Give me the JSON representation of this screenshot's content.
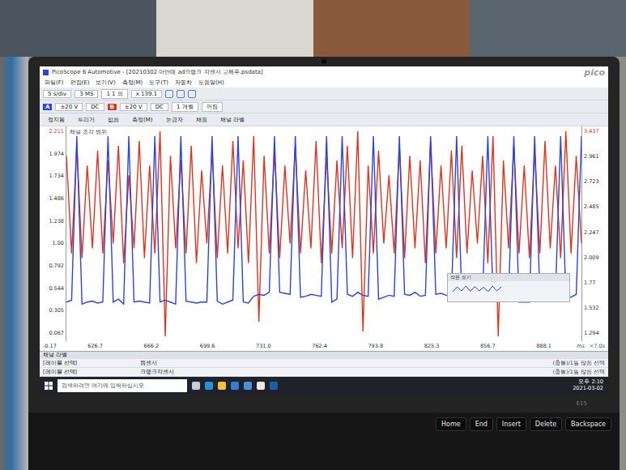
{
  "window": {
    "title": "PicoScope 6 Automotive - [20210302 아반떼 ad크랭크 각센서 교체후.psdata]",
    "logo": "pico"
  },
  "menu": [
    "파일(F)",
    "편집(E)",
    "보기(V)",
    "측정(M)",
    "도구(T)",
    "자동차",
    "도움말(H)"
  ],
  "toolbar1": [
    "5 s/div",
    "3 MS",
    "1 1 의",
    "x 139.1"
  ],
  "channels": [
    {
      "name": "A",
      "range": "±20 V",
      "coupling": "DC",
      "color": "#2a44e0"
    },
    {
      "name": "B",
      "range": "±20 V",
      "coupling": "DC",
      "color": "#e0341f"
    }
  ],
  "toolbar2": [
    "1 개월",
    "꺼짐"
  ],
  "toolbar3": [
    "정지됨",
    "트리거",
    "없음",
    "측정(M)",
    "눈금자",
    "채움",
    "채널 라벨"
  ],
  "chart": {
    "label": "채널 조각 범위",
    "left_top": "2.211",
    "right_top": "3.437",
    "y_left": [
      "1.974",
      "1.734",
      "1.486",
      "1.238",
      "1.00",
      "0.792",
      "0.544",
      "0.305",
      "0.067"
    ],
    "y_right": [
      "2.961",
      "2.723",
      "2.485",
      "2.247",
      "2.009",
      "1.77",
      "1.532",
      "1.294"
    ],
    "x_start": "-0.17",
    "x_ticks": [
      "626.7",
      "666.2",
      "699.6",
      "731.0",
      "762.4",
      "793.8",
      "825.3",
      "856.7",
      "888.1"
    ],
    "unit": "ms",
    "zoom": "×7.0s",
    "series": [
      {
        "name": "B",
        "color": "#e0341f",
        "values": [
          1.8,
          0.8,
          1.9,
          0.75,
          1.7,
          0.85,
          1.85,
          0.8,
          1.75,
          0.9,
          1.9,
          0.7,
          1.6,
          0.85,
          1.95,
          0.75,
          1.7,
          0.8,
          2.05,
          -0.05,
          1.8,
          0.85,
          1.75,
          0.8,
          1.9,
          0.7,
          1.65,
          0.9,
          1.85,
          0.75,
          1.7,
          0.8,
          1.95,
          0.85,
          1.75,
          0.7,
          2.0,
          0.1,
          1.8,
          0.8,
          1.85,
          0.75,
          1.7,
          0.9,
          1.9,
          0.8,
          1.65,
          0.85,
          1.95,
          0.7,
          1.8,
          0.8,
          1.75,
          0.85,
          1.9,
          0.75,
          2.05,
          0.0,
          1.7,
          0.8,
          1.85,
          0.9,
          1.6,
          0.8,
          1.9,
          0.75,
          1.8,
          0.85,
          1.75,
          0.7,
          1.95,
          0.8,
          1.7,
          0.85,
          1.85,
          0.75,
          1.9,
          0.8,
          1.65,
          0.9,
          1.8,
          0.7,
          2.0,
          -0.05,
          1.75,
          0.85,
          1.9,
          0.8,
          1.7,
          0.75,
          1.85,
          0.8,
          1.95,
          0.85,
          1.7,
          0.75,
          2.05,
          0.8,
          1.8,
          0.9
        ]
      },
      {
        "name": "A",
        "color": "#2a44e0",
        "values": [
          0.3,
          0.32,
          2.0,
          0.28,
          0.3,
          0.31,
          0.29,
          0.3,
          2.0,
          0.3,
          0.33,
          0.28,
          2.0,
          0.3,
          0.31,
          0.3,
          0.29,
          2.0,
          0.3,
          0.32,
          0.3,
          0.28,
          2.0,
          0.31,
          0.3,
          0.29,
          0.3,
          0.3,
          2.0,
          0.31,
          0.28,
          0.3,
          0.32,
          2.0,
          0.3,
          0.29,
          0.36,
          0.38,
          0.37,
          0.4,
          2.0,
          0.4,
          0.39,
          0.38,
          2.0,
          0.35,
          0.36,
          0.38,
          0.37,
          0.36,
          2.0,
          0.3,
          0.33,
          2.0,
          0.38,
          0.36,
          0.4,
          0.37,
          0.36,
          2.0,
          0.33,
          0.35,
          0.37,
          0.36,
          2.0,
          0.38,
          0.37,
          0.4,
          0.36,
          0.37,
          2.0,
          0.38,
          0.39,
          0.37,
          0.36,
          2.0,
          0.35,
          0.36,
          0.38,
          0.37,
          0.36,
          2.0,
          0.37,
          0.35,
          0.36,
          0.38,
          2.0,
          0.3,
          0.3,
          0.3,
          2.0,
          0.4,
          0.36,
          0.38,
          0.37,
          2.0,
          0.36,
          0.35,
          0.38,
          2.0
        ]
      }
    ],
    "overview": {
      "title": "작은 보기"
    }
  },
  "bottom_panel": {
    "title": "채널 라벨",
    "rows": [
      {
        "label": "[레이블 선택]",
        "value": "캠센서",
        "right": "(충돌)/1통 않음 선택"
      },
      {
        "label": "[레이블 선택]",
        "value": "크랭크각센서",
        "right": "(충돌)/1통 않음 선택"
      }
    ]
  },
  "taskbar": {
    "search": "검색하려면 여기에 입력하십시오",
    "time": "오후 2:10",
    "date": "2021-03-02"
  },
  "laptop": {
    "brand": "E15"
  },
  "keys": [
    "Home",
    "End",
    "Insert",
    "Delete",
    "Backspace"
  ]
}
